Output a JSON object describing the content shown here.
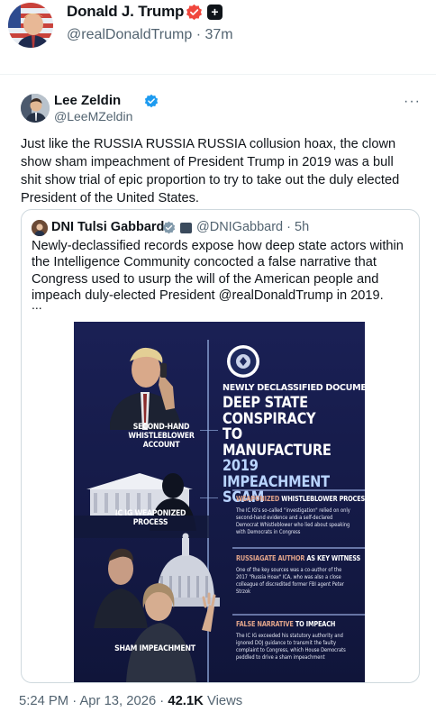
{
  "header": {
    "name": "Donald J. Trump",
    "handle_line": "@realDonaldTrump · 37m",
    "colors": {
      "gov_badge": "#f0473d",
      "text_secondary": "#536471"
    }
  },
  "quoted_post": {
    "name": "Lee Zeldin",
    "handle": "@LeeMZeldin",
    "more_icon": "···",
    "text": "Just like the RUSSIA RUSSIA RUSSIA collusion hoax, the clown show sham impeachment of President Trump in 2019 was a bull shit show trial of epic proportion to try to take out the duly elected President of the United States.",
    "colors": {
      "verified": "#1d9bf0"
    }
  },
  "nested_quote": {
    "name": "DNI Tulsi Gabbard",
    "handle_line": "@DNIGabbard · 5h",
    "text": "Newly-declassified records expose how deep state actors within the Intelligence Community concocted a false narrative that Congress used to usurp the will of the American people and impeach duly-elected President @realDonaldTrump in 2019.",
    "ellipsis": "...",
    "infographic": {
      "title_small": "NEWLY DECLASSIFIED DOCUMENTS EXPOSE",
      "title_line1": "DEEP STATE CONSPIRACY",
      "title_line2": "TO MANUFACTURE",
      "title_line3": "2019 IMPEACHMENT SCAM",
      "left_label_1": "SECOND-HAND WHISTLEBLOWER ACCOUNT",
      "left_label_2": "IC IG WEAPONIZED PROCESS",
      "left_label_3": "SHAM IMPEACHMENT",
      "sections": [
        {
          "head_highlight": "WEAPONIZED",
          "head_rest": "WHISTLEBLOWER PROCESS",
          "body": "The IC IG's so-called \"investigation\" relied on only second-hand evidence and a self-declared Democrat Whistleblower who lied about speaking with Democrats in Congress"
        },
        {
          "head_highlight": "RUSSIAGATE AUTHOR",
          "head_rest": "AS KEY WITNESS",
          "body": "One of the key sources was a co-author of the 2017 \"Russia Hoax\" ICA, who was also a close colleague of discredited former FBI agent Peter Strzok"
        },
        {
          "head_highlight": "FALSE NARRATIVE",
          "head_rest": "TO IMPEACH",
          "body": "The IC IG exceeded his statutory authority and ignored DOJ guidance to transmit the faulty complaint to Congress, which House Democrats peddled to drive a sham impeachment"
        }
      ],
      "colors": {
        "background": "#151b47",
        "accent": "#e0a38a",
        "title_accent": "#b9d4ff"
      }
    }
  },
  "footer": {
    "time_date": "5:24 PM · Apr 13, 2026 ·",
    "views_count": "42.1K",
    "views_label": "Views"
  }
}
